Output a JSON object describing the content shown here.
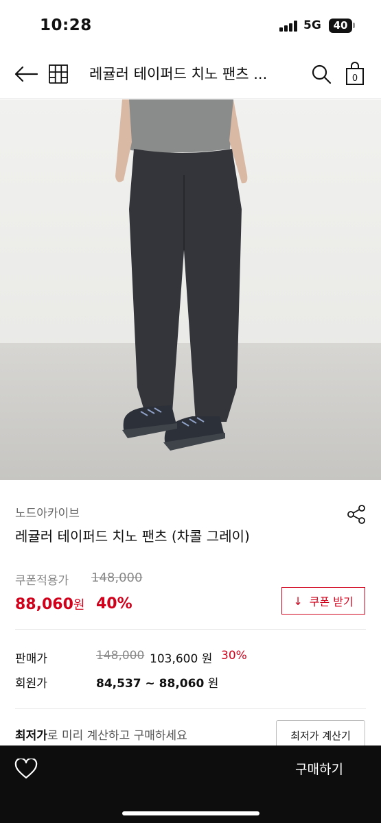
{
  "status_bar": {
    "time": "10:28",
    "network": "5G",
    "battery": "40"
  },
  "header": {
    "title": "레귤러 테이퍼드 치노 팬츠 ...",
    "cart_count": "0"
  },
  "product": {
    "brand": "노드아카이브",
    "name": "레귤러 테이퍼드 치노 팬츠 (차콜 그레이)"
  },
  "coupon": {
    "label": "쿠폰적용가",
    "original_price": "148,000",
    "price": "88,060",
    "price_unit": "원",
    "rate": "40%",
    "button_icon": "↓",
    "button_label": "쿠폰 받기"
  },
  "sale": {
    "label": "판매가",
    "original_price": "148,000",
    "price": "103,600 원",
    "rate": "30%"
  },
  "member": {
    "label": "회원가",
    "range": "84,537 ~ 88,060",
    "unit": " 원"
  },
  "lowest": {
    "highlight": "최저가",
    "text": "로 미리 계산하고 구매하세요",
    "button_label": "최저가 계산기"
  },
  "bottom_bar": {
    "buy_label": "구매하기"
  },
  "colors": {
    "accent": "#d0021b",
    "bottom_bar": "#0d0d0d",
    "background": "#ffffff"
  },
  "icons": [
    "back-arrow-icon",
    "store-icon",
    "search-icon",
    "cart-icon",
    "share-icon",
    "heart-icon"
  ]
}
